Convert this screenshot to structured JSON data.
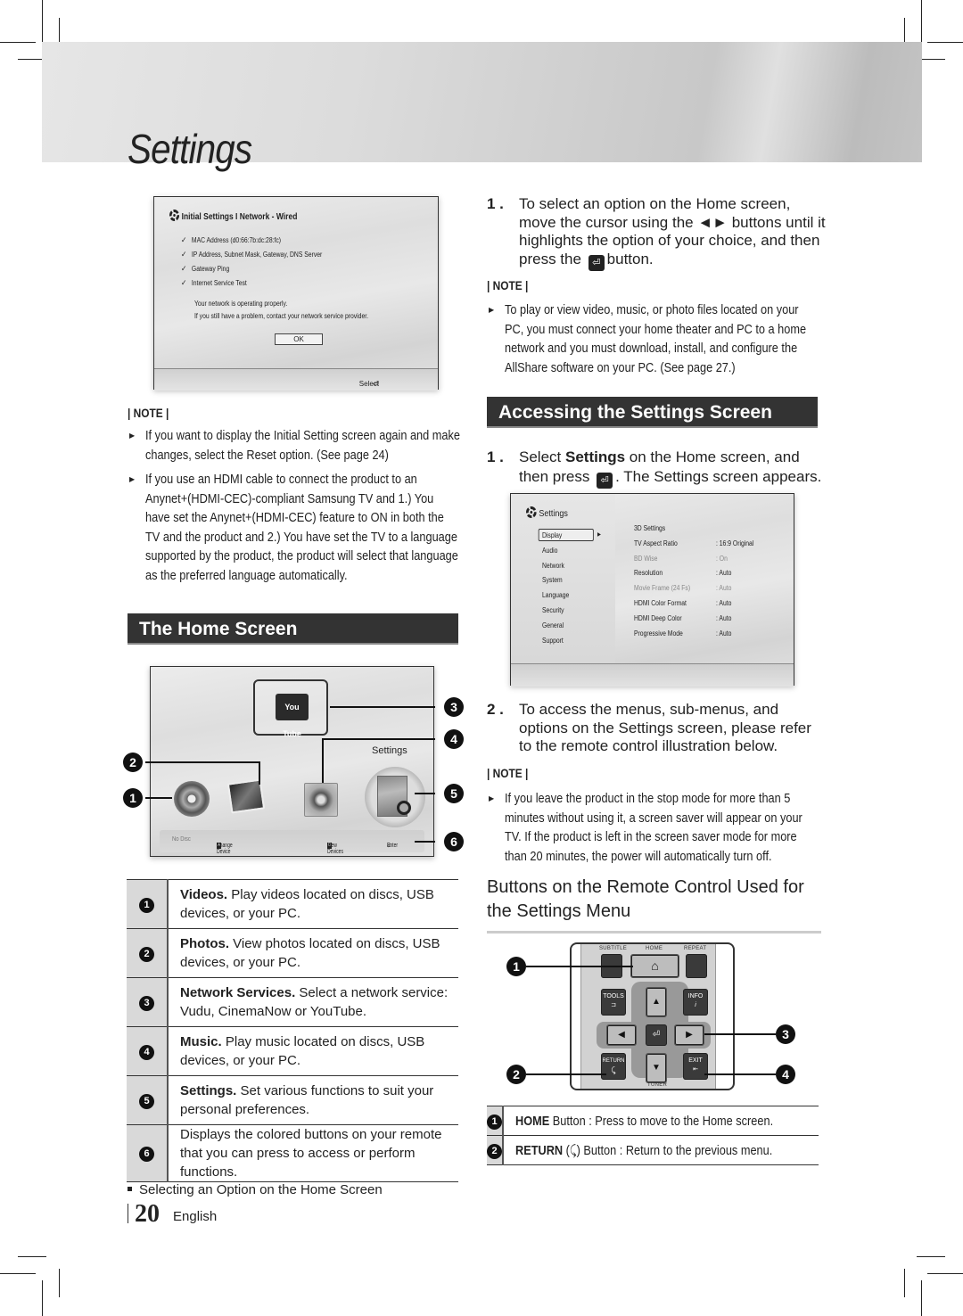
{
  "page": {
    "title": "Settings",
    "page_number": "20",
    "language": "English"
  },
  "initial_settings_screen": {
    "title": "Initial Settings I Network - Wired",
    "checks": [
      "MAC Address (d0:66:7b:dc:28:fc)",
      "IP Address, Subnet Mask, Gateway, DNS Server",
      "Gateway Ping",
      "Internet Service Test"
    ],
    "message_line1": "Your network is operating properly.",
    "message_line2": "If you still have a problem, contact your network service provider.",
    "ok_button": "OK",
    "footer_select": "Select"
  },
  "note1": {
    "label": "| NOTE |",
    "items": [
      "If you want to display the Initial Setting screen again and make changes, select the Reset option. (See page 24)",
      "If you use an HDMI cable to connect the product to an Anynet+(HDMI-CEC)-compliant Samsung TV and 1.) You have set the Anynet+(HDMI-CEC) feature to ON in both the TV and the product and 2.) You have set the TV to a language supported by the product, the product will select that language as the preferred language automatically."
    ]
  },
  "home_screen_section": {
    "heading": "The Home Screen",
    "screen": {
      "youtube_label": "You Tube",
      "settings_label": "Settings",
      "bar": {
        "no_disc": "No Disc",
        "change_device_key": "A",
        "change_device": "Change Device",
        "view_devices_key": "D",
        "view_devices": "View Devices",
        "enter": "Enter"
      }
    },
    "callouts": [
      "1",
      "2",
      "3",
      "4",
      "5",
      "6"
    ],
    "table": [
      {
        "num": "1",
        "bold": "Videos.",
        "text": " Play videos located on discs, USB devices, or your PC."
      },
      {
        "num": "2",
        "bold": "Photos.",
        "text": " View photos located on discs, USB devices, or your PC."
      },
      {
        "num": "3",
        "bold": "Network Services.",
        "text": " Select a network service: Vudu, CinemaNow or YouTube."
      },
      {
        "num": "4",
        "bold": "Music.",
        "text": " Play music located on discs, USB devices, or your PC."
      },
      {
        "num": "5",
        "bold": "Settings.",
        "text": " Set various functions to suit your personal preferences."
      },
      {
        "num": "6",
        "bold": "",
        "text": "Displays the colored buttons on your remote that you can press to access or perform functions."
      }
    ],
    "caption": "Selecting an Option on the Home Screen"
  },
  "right_column": {
    "step1": {
      "num": "1 .",
      "text_a": "To select an option on the Home screen, move the cursor using the ◄► buttons until it highlights the option of your choice, and then press the",
      "text_b": "button."
    },
    "note2": {
      "label": "| NOTE |",
      "items": [
        "To play or view video, music, or photo files located on your PC, you must connect your home theater and PC to a home network and you must download, install, and configure the AllShare software on your PC. (See page 27.)"
      ]
    },
    "accessing_heading": "Accessing the Settings Screen",
    "access_step1": {
      "num": "1 .",
      "pre": "Select ",
      "bold": "Settings",
      "mid": " on the Home screen, and then press",
      "post": ". The Settings screen appears."
    },
    "settings_screen": {
      "title": "Settings",
      "menu": [
        "Display",
        "Audio",
        "Network",
        "System",
        "Language",
        "Security",
        "General",
        "Support"
      ],
      "selected_menu": "Display",
      "options": [
        {
          "key": "3D Settings",
          "value": "",
          "dim": false
        },
        {
          "key": "TV Aspect Ratio",
          "value": ":  16:9 Original",
          "dim": false
        },
        {
          "key": "BD Wise",
          "value": ":  On",
          "dim": true
        },
        {
          "key": "Resolution",
          "value": ":  Auto",
          "dim": false
        },
        {
          "key": "Movie Frame (24 Fs)",
          "value": ":  Auto",
          "dim": true
        },
        {
          "key": "HDMI Color Format",
          "value": ":  Auto",
          "dim": false
        },
        {
          "key": "HDMI Deep Color",
          "value": ":  Auto",
          "dim": false
        },
        {
          "key": "Progressive Mode",
          "value": ":  Auto",
          "dim": false
        }
      ]
    },
    "access_step2": {
      "num": "2 .",
      "text": "To access the menus, sub-menus, and options on the Settings screen, please refer to the remote control illustration below."
    },
    "note3": {
      "label": "| NOTE |",
      "items": [
        "If you leave the product in the stop mode for more than 5 minutes without using it, a screen saver will appear on your TV. If the product is left in the screen saver mode for more than 20 minutes, the power will automatically turn off."
      ]
    },
    "remote_heading": "Buttons on the Remote Control Used for the Settings Menu",
    "remote": {
      "labels": {
        "subtitle": "SUBTITLE",
        "home": "HOME",
        "repeat": "REPEAT",
        "tools": "TOOLS",
        "info": "INFO",
        "info_sym": "i",
        "return": "RETURN",
        "exit": "EXIT",
        "tuner": "TUNER"
      },
      "callouts": [
        "1",
        "2",
        "3",
        "4"
      ]
    },
    "remote_table": [
      {
        "num": "1",
        "bold": "HOME",
        "text": " Button : Press to move to the Home screen."
      },
      {
        "num": "2",
        "bold": "RETURN",
        "text": " (⤹) Button : Return to the previous menu."
      }
    ]
  }
}
